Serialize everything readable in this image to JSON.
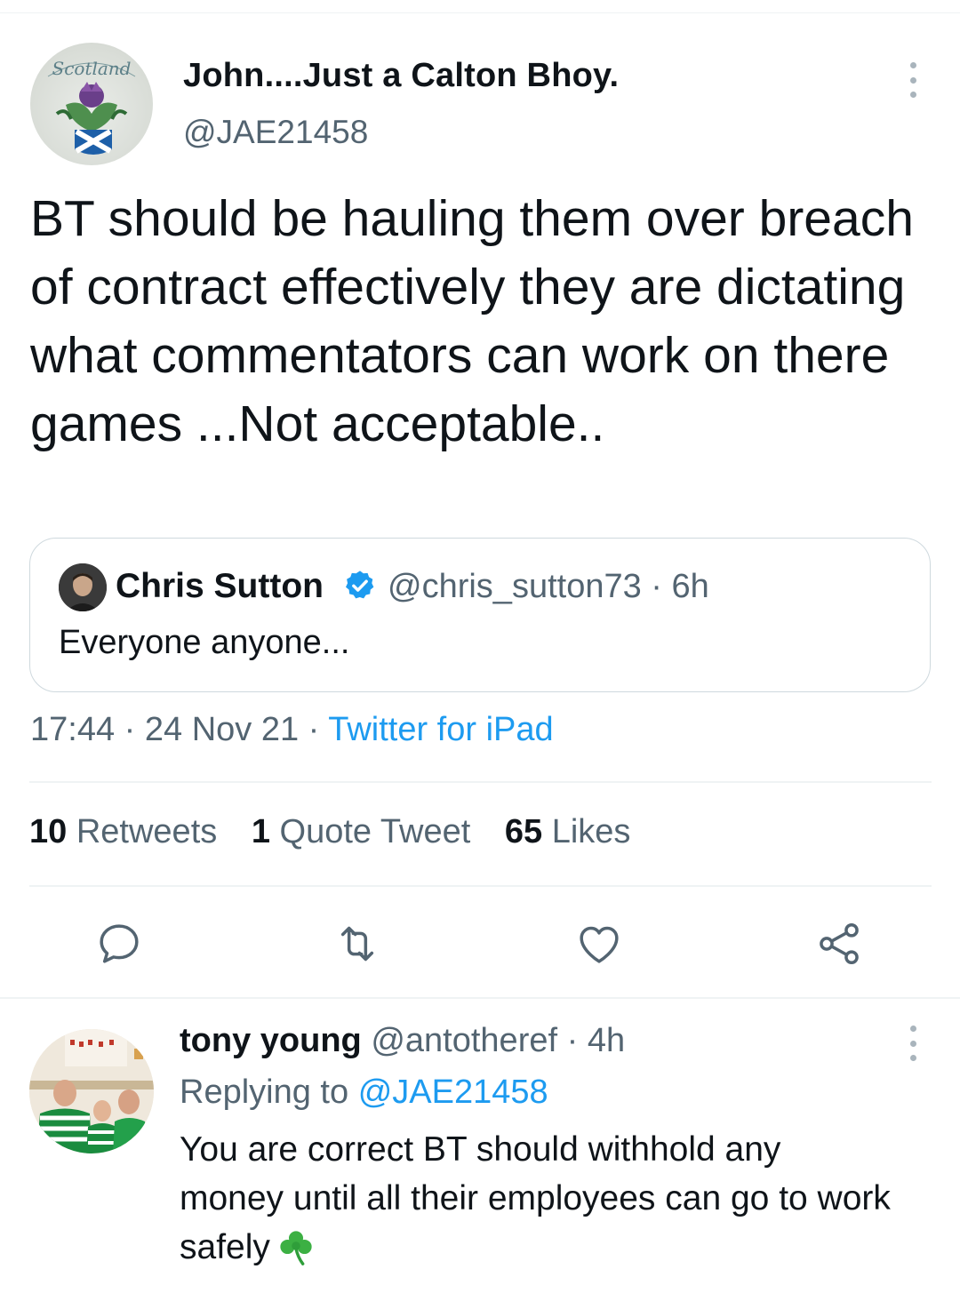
{
  "main_tweet": {
    "author_name": "John....Just a Calton Bhoy.",
    "author_handle": "@JAE21458",
    "avatar_text": "Scotland",
    "text": "BT should be hauling them over breach of contract effectively they are dictating what commentators can work on there games ...Not acceptable..",
    "quote": {
      "name": "Chris Sutton",
      "handle_time": "@chris_sutton73 · 6h",
      "text": "Everyone anyone..."
    },
    "time": "17:44",
    "date": "24 Nov 21",
    "source": "Twitter for iPad",
    "stats": {
      "retweets_count": "10",
      "retweets_label": "Retweets",
      "quotes_count": "1",
      "quotes_label": "Quote Tweet",
      "likes_count": "65",
      "likes_label": "Likes"
    },
    "actions": [
      "reply-icon",
      "retweet-icon",
      "like-icon",
      "share-icon"
    ]
  },
  "reply": {
    "name": "tony young",
    "handle": "@antotheref",
    "time": "4h",
    "replying_label": "Replying to",
    "replying_handle": "@JAE21458",
    "text": "You are correct BT should withhold any money until all their employees can go to work safely",
    "emoji": "shamrock-icon"
  },
  "colors": {
    "link": "#1d9bf0",
    "secondary_text": "#536471",
    "primary_text": "#0f1419",
    "border": "#cfd9de",
    "shamrock": "#3cb043"
  }
}
